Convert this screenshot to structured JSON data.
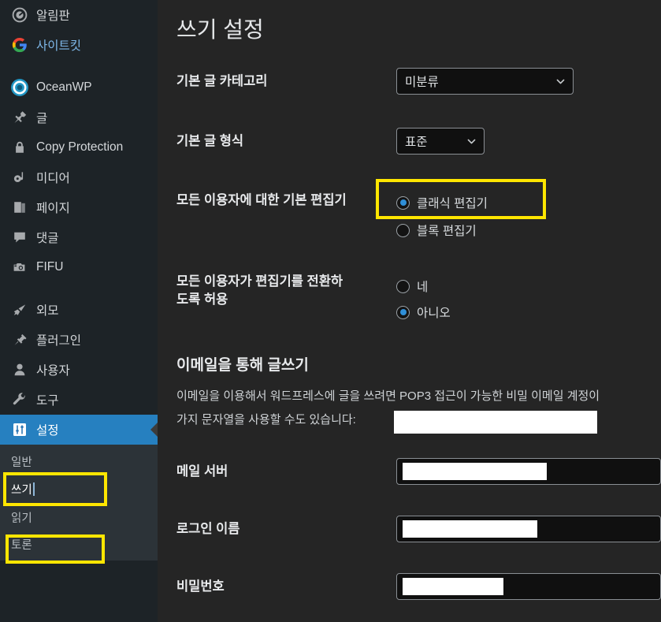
{
  "sidebar": {
    "items": [
      {
        "label": "알림판",
        "icon": "dashboard-icon"
      },
      {
        "label": "사이트킷",
        "icon": "google-g-icon"
      },
      {
        "label": "OceanWP",
        "icon": "oceanwp-icon"
      },
      {
        "label": "글",
        "icon": "pin-icon"
      },
      {
        "label": "Copy Protection",
        "icon": "lock-icon"
      },
      {
        "label": "미디어",
        "icon": "media-icon"
      },
      {
        "label": "페이지",
        "icon": "pages-icon"
      },
      {
        "label": "댓글",
        "icon": "comment-icon"
      },
      {
        "label": "FIFU",
        "icon": "camera-icon"
      },
      {
        "label": "외모",
        "icon": "brush-icon"
      },
      {
        "label": "플러그인",
        "icon": "plug-icon"
      },
      {
        "label": "사용자",
        "icon": "user-icon"
      },
      {
        "label": "도구",
        "icon": "wrench-icon"
      },
      {
        "label": "설정",
        "icon": "settings-sliders-icon"
      }
    ],
    "submenu": [
      {
        "label": "일반"
      },
      {
        "label": "쓰기"
      },
      {
        "label": "읽기"
      },
      {
        "label": "토론"
      }
    ]
  },
  "main": {
    "page_title": "쓰기 설정",
    "rows": {
      "default_category_label": "기본 글 카테고리",
      "default_category_value": "미분류",
      "default_format_label": "기본 글 형식",
      "default_format_value": "표준",
      "default_editor_label": "모든 이용자에 대한 기본 편집기",
      "editor_classic": "클래식 편집기",
      "editor_block": "블록 편집기",
      "allow_switch_label_line1": "모든 이용자가 편집기를 전환하",
      "allow_switch_label_line2": "도록 허용",
      "switch_yes": "네",
      "switch_no": "아니오"
    },
    "email_section": {
      "heading": "이메일을 통해 글쓰기",
      "paragraph_line1": "이메일을 이용해서 워드프레스에 글을 쓰려면 POP3 접근이 가능한 비밀 이메일 계정이",
      "paragraph_line2": "가지 문자열을 사용할 수도 있습니다:",
      "mail_server_label": "메일 서버",
      "login_name_label": "로그인 이름",
      "password_label": "비밀번호"
    }
  },
  "colors": {
    "sidebar_bg": "#1d2327",
    "submenu_bg": "#2c3338",
    "main_bg": "#252525",
    "accent_blue": "#2680c0",
    "radio_blue": "#2f8fd8",
    "highlight_yellow": "#ffe600",
    "sitekit_link": "#7eb7e8"
  }
}
